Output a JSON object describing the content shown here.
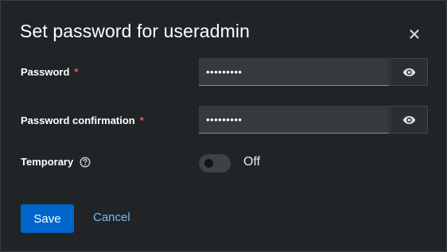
{
  "modal": {
    "title": "Set password for useradmin",
    "close_icon": "close-icon"
  },
  "form": {
    "password": {
      "label": "Password",
      "required_marker": "*",
      "value": "•••••••••",
      "toggle_icon": "eye-icon"
    },
    "password_confirmation": {
      "label": "Password confirmation",
      "required_marker": "*",
      "value": "•••••••••",
      "toggle_icon": "eye-icon"
    },
    "temporary": {
      "label": "Temporary",
      "help_icon": "question-circle-icon",
      "state_text": "Off",
      "checked": false
    }
  },
  "actions": {
    "save_label": "Save",
    "cancel_label": "Cancel"
  },
  "colors": {
    "primary": "#0066cc",
    "link": "#73bcf7",
    "required": "#f0544f",
    "background": "#212427"
  }
}
